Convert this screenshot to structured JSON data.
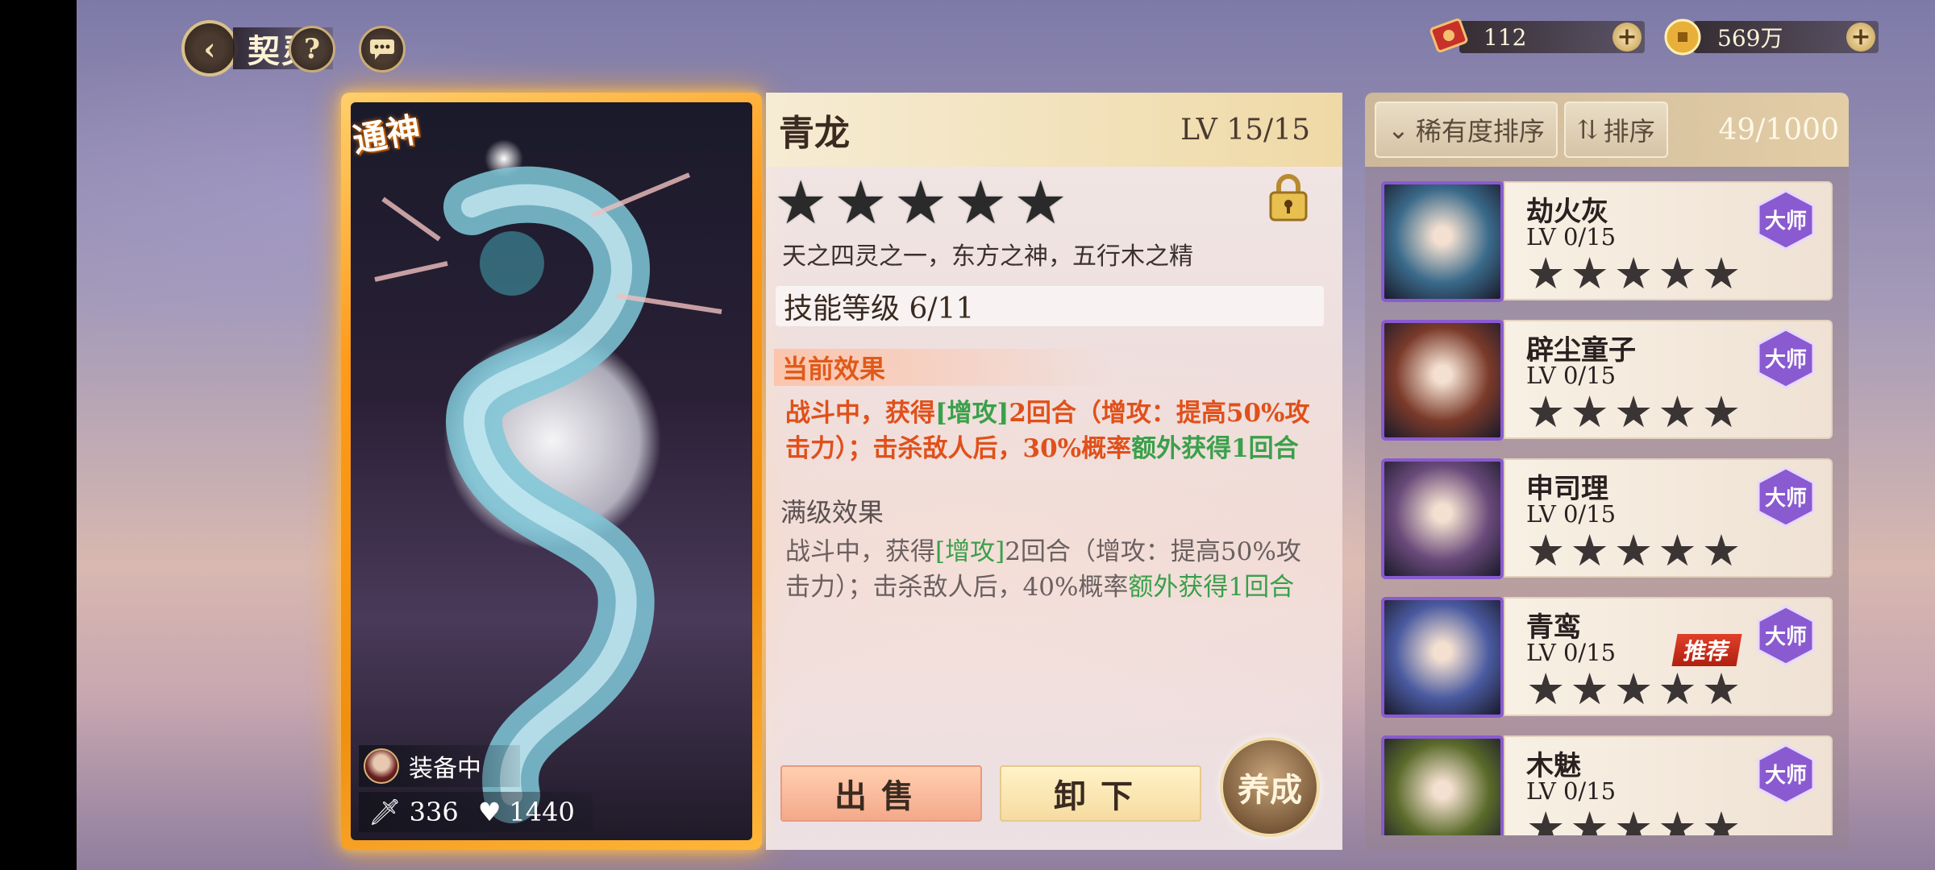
{
  "header": {
    "back_label": "契灵",
    "help_glyph": "?",
    "chat_glyph": "…"
  },
  "currencies": [
    {
      "icon": "ticket-icon",
      "value": "112"
    },
    {
      "icon": "coin-icon",
      "value": "569万"
    }
  ],
  "card": {
    "badge": "通神",
    "equipped_label": "装备中",
    "attack": "336",
    "health": "1440"
  },
  "detail": {
    "name": "青龙",
    "level": "LV 15/15",
    "stars": 5,
    "description": "天之四灵之一，东方之神，五行木之精",
    "skill_level": "技能等级 6/11",
    "current_effect_title": "当前效果",
    "current_effect": {
      "p1": "战斗中，获得",
      "h1": "[增攻]",
      "p2": "2回合（增攻：提高50%攻击力）；击杀敌人后，30%概率",
      "h2": "额外获得1回合"
    },
    "max_effect_title": "满级效果",
    "max_effect": {
      "p1": "战斗中，获得",
      "h1": "[增攻]",
      "p2": "2回合（增攻：提高50%攻击力）；击杀敌人后，40%概率",
      "h2": "额外获得1回合"
    },
    "sell_label": "出售",
    "unload_label": "卸下",
    "foster_label": "养成"
  },
  "list": {
    "sort_rarity_label": "稀有度排序",
    "sort_label": "排序",
    "count": "49/1000",
    "master_badge": "大师",
    "recommend_badge": "推荐",
    "items": [
      {
        "name": "劫火灰",
        "level": "LV 0/15",
        "recommended": false,
        "color": "#3a6a8a"
      },
      {
        "name": "辟尘童子",
        "level": "LV 0/15",
        "recommended": false,
        "color": "#7a3a2a"
      },
      {
        "name": "申司理",
        "level": "LV 0/15",
        "recommended": false,
        "color": "#6a4a7a"
      },
      {
        "name": "青鸾",
        "level": "LV 0/15",
        "recommended": true,
        "color": "#4a5aa0"
      },
      {
        "name": "木魅",
        "level": "LV 0/15",
        "recommended": false,
        "color": "#5a6a2a"
      }
    ]
  },
  "colors": {
    "accent_orange": "#ff9a1a",
    "effect_red": "#e0501a",
    "highlight_green": "#3aa04a",
    "rarity_purple": "#8a5ad0"
  }
}
